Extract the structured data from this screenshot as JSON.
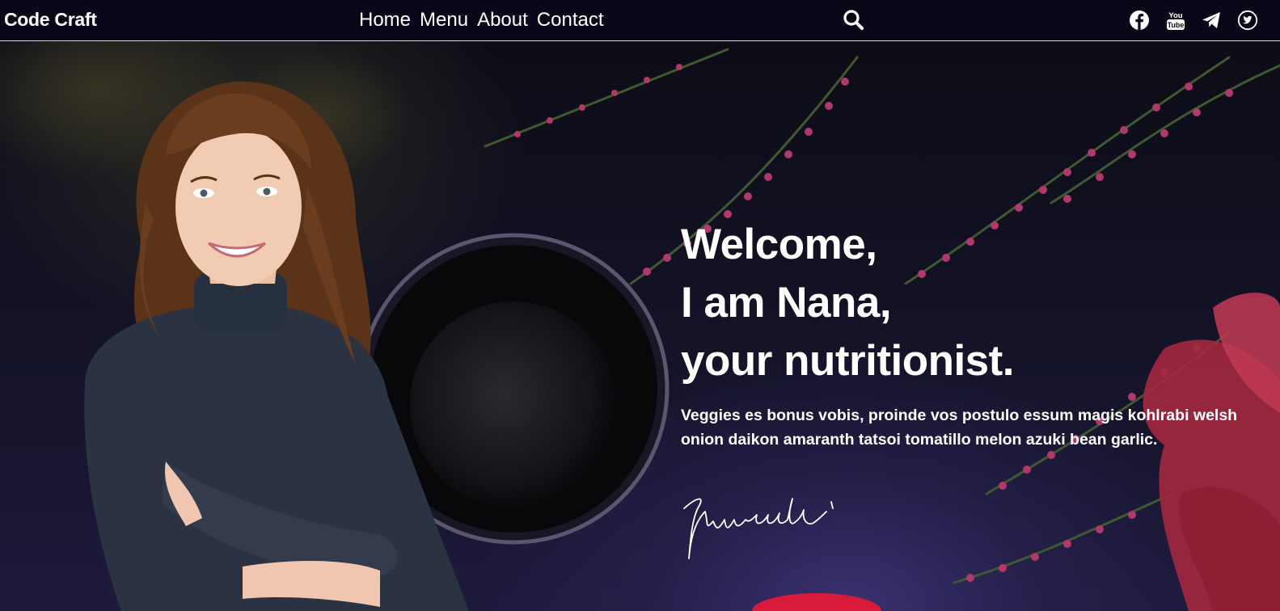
{
  "brand": {
    "name": "Code Craft"
  },
  "nav": {
    "links": [
      {
        "label": "Home"
      },
      {
        "label": "Menu"
      },
      {
        "label": "About"
      },
      {
        "label": "Contact"
      }
    ],
    "search_icon": "search-icon"
  },
  "social": [
    {
      "name": "facebook-icon"
    },
    {
      "name": "youtube-icon"
    },
    {
      "name": "telegram-icon"
    },
    {
      "name": "twitter-icon"
    }
  ],
  "hero": {
    "title_line1": "Welcome,",
    "title_line2": "I am Nana,",
    "title_line3": "your nutritionist.",
    "description": "Veggies es bonus vobis, proinde vos postulo essum magis kohlrabi welsh onion daikon amaranth tatsoi tomatillo melon azuki bean garlic."
  },
  "colors": {
    "navbar_bg": "#0a0818",
    "text": "#ffffff",
    "flower_accent": "#b0386a"
  }
}
